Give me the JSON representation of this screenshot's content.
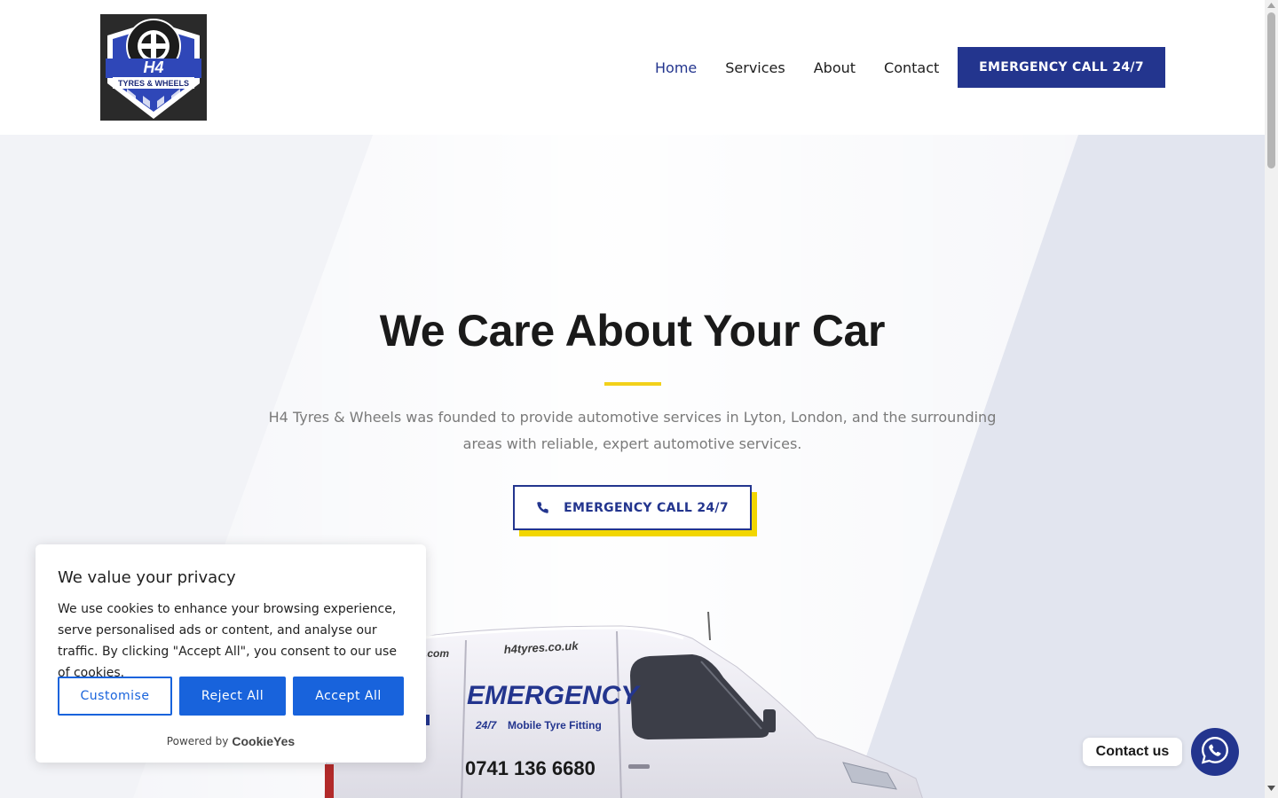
{
  "header": {
    "logo": {
      "text_top": "H4",
      "text_bottom": "TYRES & WHEELS",
      "icon": "tyre-shield-logo"
    },
    "nav": [
      {
        "label": "Home",
        "active": true
      },
      {
        "label": "Services",
        "active": false
      },
      {
        "label": "About",
        "active": false
      },
      {
        "label": "Contact",
        "active": false
      }
    ],
    "cta_label": "EMERGENCY CALL 24/7"
  },
  "hero": {
    "title": "We Care About Your Car",
    "description": "H4 Tyres & Wheels was founded to provide automotive services in Lyton, London, and the surrounding areas with reliable, expert automotive services.",
    "cta_label": "EMERGENCY CALL 24/7",
    "cta_icon": "phone-icon"
  },
  "van": {
    "website": "h4tyres.co.uk",
    "website_fragment": ".com",
    "headline": "EMERGENCY",
    "service": "Mobile Tyre Fitting",
    "badge": "24/7",
    "phone": "0741 136 6680"
  },
  "cookie": {
    "title": "We value your privacy",
    "text": "We use cookies to enhance your browsing experience, serve personalised ads or content, and analyse our traffic. By clicking \"Accept All\", you consent to our use of cookies.",
    "customise_label": "Customise",
    "reject_label": "Reject All",
    "accept_label": "Accept All",
    "powered_by": "Powered by",
    "brand": "CookieYes"
  },
  "contact_widget": {
    "label": "Contact us",
    "icon": "whatsapp-icon"
  },
  "colors": {
    "brand_navy": "#23358e",
    "accent_yellow": "#f2d11a",
    "cookie_blue": "#1863dc"
  }
}
